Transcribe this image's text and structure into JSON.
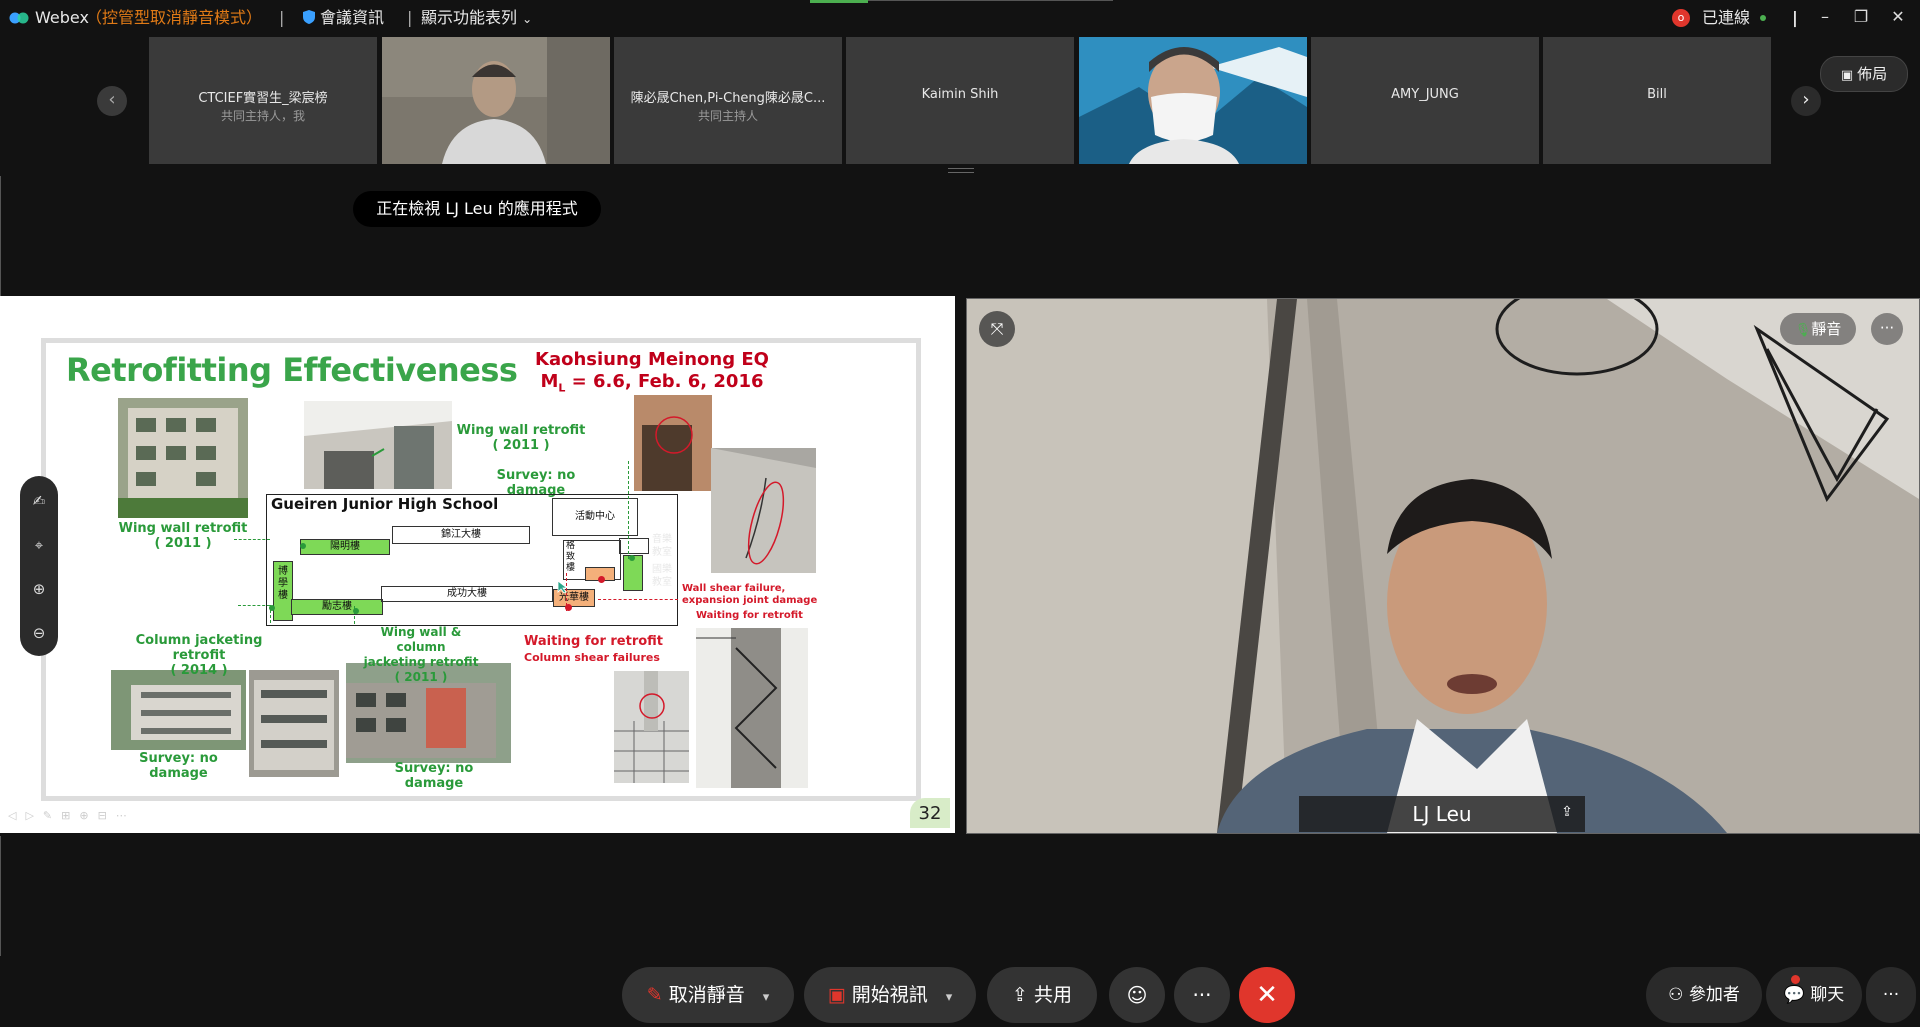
{
  "titlebar": {
    "app_name": "Webex",
    "mode_label": "（控管型取消靜音模式）",
    "separator": "|",
    "meeting_info": "會議資訊",
    "show_menu": "顯示功能表列",
    "record_badge": "o",
    "connected_label": "已連線",
    "minimize": "–",
    "restore": "❐",
    "close": "✕"
  },
  "participants": [
    {
      "name": "CTCIEF實習生_梁宸榜",
      "role": "共同主持人，我",
      "has_video": false
    },
    {
      "name": "",
      "role": "",
      "has_video": true
    },
    {
      "name": "陳必晟Chen,Pi-Cheng陳必晟C...",
      "role": "共同主持人",
      "has_video": false
    },
    {
      "name": "Kaimin Shih",
      "role": "",
      "has_video": false
    },
    {
      "name": "",
      "role": "",
      "has_video": true
    },
    {
      "name": "AMY_JUNG",
      "role": "",
      "has_video": false
    },
    {
      "name": "Bill",
      "role": "",
      "has_video": false
    }
  ],
  "strip": {
    "prev": "‹",
    "next": "›",
    "layout_label": "佈局"
  },
  "viewing_notice": "正在檢視 LJ Leu 的應用程式",
  "slide": {
    "title": "Retrofitting Effectiveness",
    "eq_title": "Kaohsiung Meinong EQ",
    "eq_magnitude": "M",
    "eq_sub": "L",
    "eq_rest": " = 6.6, Feb. 6, 2016",
    "school_name": "Gueiren Junior High School",
    "labels": {
      "wing_wall_1": "Wing wall retrofit",
      "wing_wall_1_year": "( 2011 )",
      "wing_wall_2": "Wing wall retrofit",
      "wing_wall_2_year": "( 2011 )",
      "survey_top": "Survey: no damage",
      "col_jacket": "Column jacketing",
      "col_jacket_2": "retrofit",
      "col_jacket_year": "( 2014 )",
      "wing_col": "Wing wall & column",
      "wing_col_2": "jacketing retrofit",
      "wing_col_year": "( 2011 )",
      "survey_left": "Survey: no damage",
      "survey_mid": "Survey: no damage",
      "waiting": "Waiting for retrofit",
      "col_shear": "Column shear failures",
      "wall_shear": "Wall shear failure,",
      "expansion": "expansion joint damage",
      "waiting_2": "Waiting for retrofit"
    },
    "buildings": {
      "yangming": "陽明樓",
      "jinjiang": "錦江大樓",
      "activity": "活動中心",
      "music": "音樂\n教室",
      "national_music": "國樂\n教室",
      "boxue": "博\n學\n樓",
      "lizhi": "勵志樓",
      "chenggong": "成功大樓",
      "guanghua": "光華樓",
      "gezhi": "格\n致\n樓"
    },
    "page_number": "32"
  },
  "video": {
    "speaker_name": "LJ Leu",
    "mute_label": "靜音",
    "more": "···"
  },
  "toolbar": {
    "unmute": "取消靜音",
    "start_video": "開始視訊",
    "share": "共用",
    "more": "···",
    "participants": "參加者",
    "chat": "聊天",
    "more_right": "···"
  }
}
